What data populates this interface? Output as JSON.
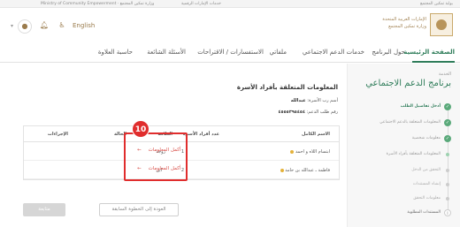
{
  "gov_strip": {
    "left_text": "Ministry of Community Empowerment · وزارة تمكين المجتمع",
    "middle_text": "خدمات الإمارات الرقمية",
    "right_text": "بوابة تمكين المجتمع"
  },
  "header": {
    "ministry_line1": "الإمارات العربية المتحدة",
    "ministry_line2": "وزارة تمكين المجتمع",
    "language_link": "English",
    "accessibility_icon": "accessibility-icon",
    "notification_icon": "bell-icon",
    "user_icon": "user-icon"
  },
  "nav": {
    "items": [
      "الصفحة الرئيسية",
      "حول البرنامج",
      "خدمات الدعم الاجتماعي",
      "ملفاتي",
      "الاستفسارات / الاقتراحات",
      "الأسئلة الشائعة",
      "حاسبة العلاوة"
    ]
  },
  "sidebar": {
    "service_label": "الخدمة",
    "service_title": "برنامج الدعم الاجتماعي",
    "steps": [
      {
        "label": "أدخل تفاصيل الطلب",
        "state": "done"
      },
      {
        "label": "المعلومات المتعلقة بالدعم الاجتماعي",
        "state": "done"
      },
      {
        "label": "معلومات شخصية",
        "state": "done"
      },
      {
        "label": "المعلومات المتعلقة بأفراد الأسرة",
        "state": "current"
      },
      {
        "label": "التحقق من الدخل",
        "state": "pending"
      },
      {
        "label": "إنشاء المستندات",
        "state": "pending"
      },
      {
        "label": "معلومات التحقق",
        "state": "pending"
      },
      {
        "label": "المستندات المطلوبة",
        "state": "pending"
      }
    ]
  },
  "main": {
    "section_title": "المعلومات المتعلقة بأفراد الأسرة",
    "head_label": "أسم رب الأسرة:",
    "head_value": "عبدالله",
    "number_label": "رقم طلب الدعم:",
    "number_value": "٤٥٥٥٣٩٥٤٥٤",
    "table": {
      "headers": [
        "الاسم الكامل",
        "عدد أفراد الأسرة",
        "العلاقة",
        "الحالة",
        "الإجراءات"
      ],
      "rows": [
        {
          "name": "ابتسام اللاه و احمد",
          "count": "1",
          "relation": "زوجة",
          "action_label": "أكمل المعلومات"
        },
        {
          "name": "فاطمة ـ عبدالله بن حامد",
          "count": "2",
          "relation": "ابن",
          "action_label": "أكمل المعلومات"
        }
      ]
    },
    "callout_number": "10",
    "back_button": "العودة إلى الخطوة السابقة",
    "next_button": "متابعة"
  }
}
